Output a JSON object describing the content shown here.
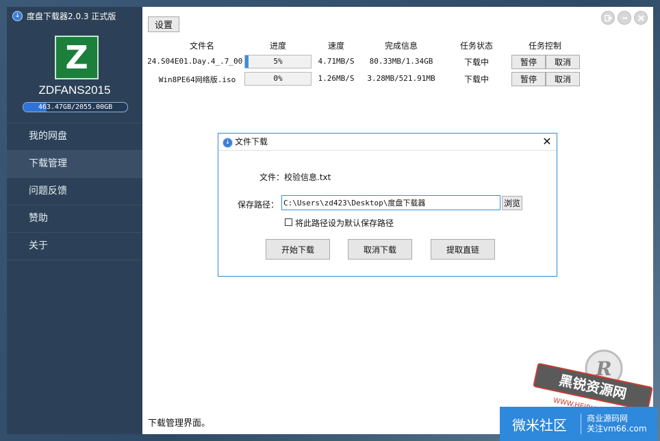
{
  "app": {
    "title": "度盘下载器2.0.3 正式版",
    "username": "ZDFANS2015",
    "logo_letter": "Z",
    "quota_text": "463.47GB/2055.00GB",
    "quota_fraction": 0.2255
  },
  "sidebar": {
    "items": [
      {
        "label": "我的网盘"
      },
      {
        "label": "下载管理"
      },
      {
        "label": "问题反馈"
      },
      {
        "label": "赞助"
      },
      {
        "label": "关于"
      }
    ],
    "active_index": 1
  },
  "toolbar": {
    "settings_label": "设置"
  },
  "window_controls": {
    "exit_icon": "exit-icon",
    "minimize_icon": "minimize-icon",
    "close_icon": "close-icon"
  },
  "table": {
    "headers": [
      "文件名",
      "进度",
      "速度",
      "完成信息",
      "任务状态",
      "任务控制"
    ],
    "rows": [
      {
        "name": "24.S04E01.Day.4_.7_00.",
        "progress_text": "5%",
        "progress": 0.05,
        "speed": "4.71MB/S",
        "done": "80.33MB/1.34GB",
        "status": "下载中",
        "pause": "暂停",
        "cancel": "取消"
      },
      {
        "name": "Win8PE64网络版.iso",
        "progress_text": "0%",
        "progress": 0.0,
        "speed": "1.26MB/S",
        "done": "3.28MB/521.91MB",
        "status": "下载中",
        "pause": "暂停",
        "cancel": "取消"
      }
    ]
  },
  "status_bar": {
    "text": "下载管理界面。"
  },
  "dialog": {
    "title": "文件下载",
    "file_label": "文件：校验信息.txt",
    "path_label": "保存路径：",
    "path_value": "C:\\Users\\zd423\\Desktop\\度盘下载器",
    "browse_label": "浏览",
    "default_checkbox_label": "将此路径设为默认保存路径",
    "start_label": "开始下载",
    "cancel_label": "取消下载",
    "link_label": "提取直链"
  },
  "watermark": {
    "stamp_text": "黑锐资源网",
    "stamp_url": "WWW.HEIRUI",
    "panel_left": "微米社区",
    "panel_right_line1": "商业源码网",
    "panel_right_line2": "关注vm66.com"
  },
  "colors": {
    "sidebar_bg": "#2c4157",
    "accent": "#2f86d8",
    "progress_fill": "#3c8fd8",
    "logo_green": "#1d7f3c"
  }
}
